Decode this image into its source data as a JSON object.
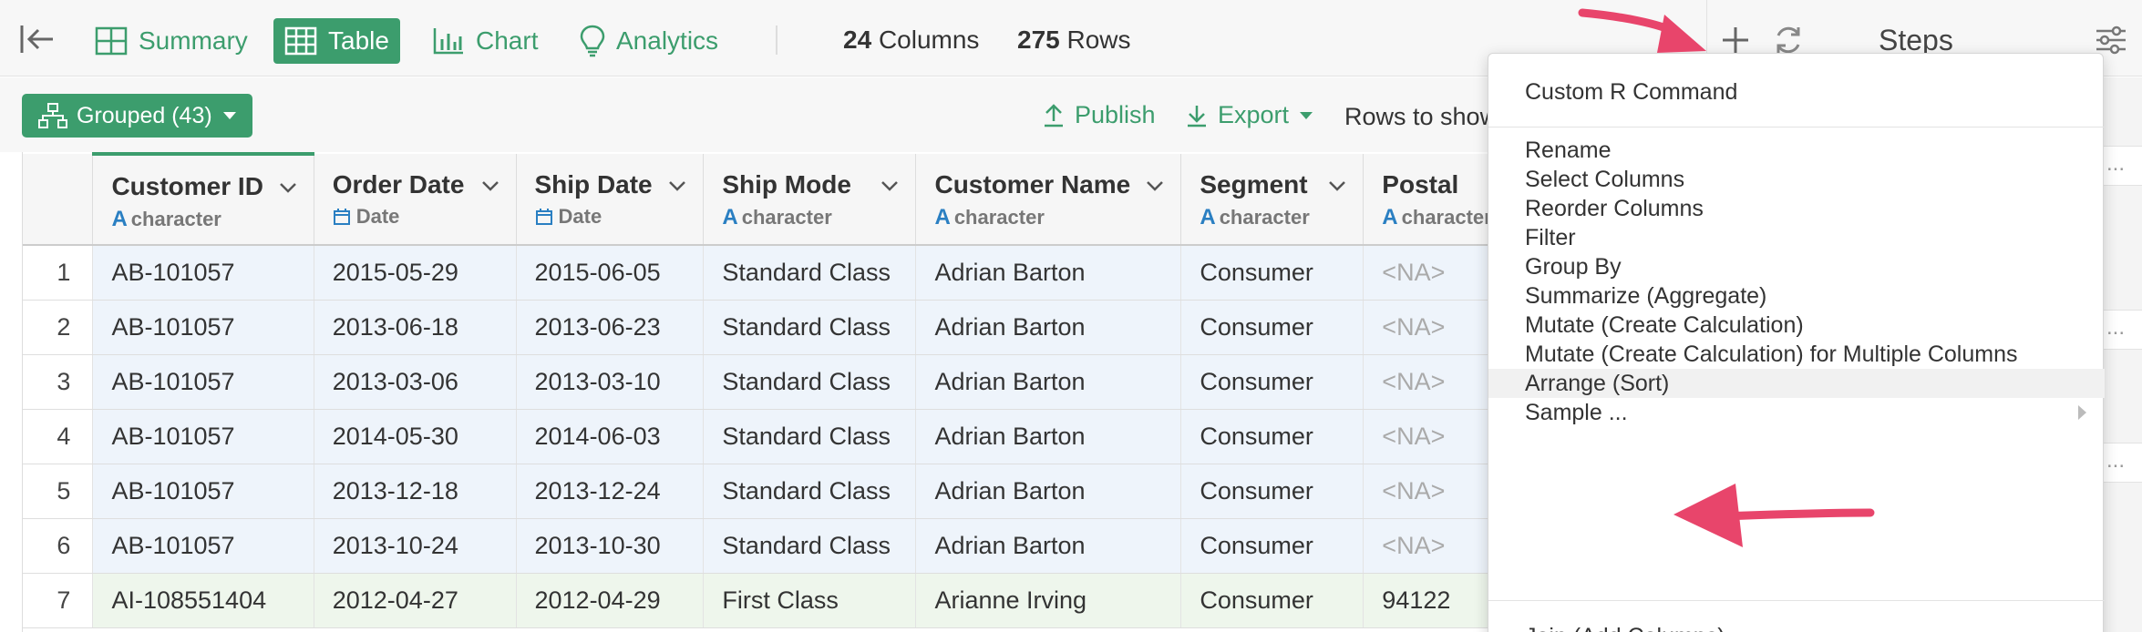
{
  "toolbar": {
    "tabs": [
      {
        "label": "Summary",
        "icon": "summary-grid-icon"
      },
      {
        "label": "Table",
        "icon": "table-icon"
      },
      {
        "label": "Chart",
        "icon": "bar-chart-icon"
      },
      {
        "label": "Analytics",
        "icon": "lightbulb-icon"
      }
    ],
    "columns_count": "24",
    "columns_label": "Columns",
    "rows_count": "275",
    "rows_label": "Rows",
    "steps_title": "Steps"
  },
  "subbar": {
    "grouped_label": "Grouped (43)",
    "publish_label": "Publish",
    "export_label": "Export",
    "rows_to_show_label": "Rows to show"
  },
  "table": {
    "columns": [
      {
        "name": "Customer ID",
        "type": "character"
      },
      {
        "name": "Order Date",
        "type": "Date"
      },
      {
        "name": "Ship Date",
        "type": "Date"
      },
      {
        "name": "Ship Mode",
        "type": "character"
      },
      {
        "name": "Customer Name",
        "type": "character"
      },
      {
        "name": "Segment",
        "type": "character"
      },
      {
        "name": "Postal",
        "type": "character"
      }
    ],
    "rows": [
      [
        "1",
        "AB-101057",
        "2015-05-29",
        "2015-06-05",
        "Standard Class",
        "Adrian Barton",
        "Consumer",
        "<NA>"
      ],
      [
        "2",
        "AB-101057",
        "2013-06-18",
        "2013-06-23",
        "Standard Class",
        "Adrian Barton",
        "Consumer",
        "<NA>"
      ],
      [
        "3",
        "AB-101057",
        "2013-03-06",
        "2013-03-10",
        "Standard Class",
        "Adrian Barton",
        "Consumer",
        "<NA>"
      ],
      [
        "4",
        "AB-101057",
        "2014-05-30",
        "2014-06-03",
        "Standard Class",
        "Adrian Barton",
        "Consumer",
        "<NA>"
      ],
      [
        "5",
        "AB-101057",
        "2013-12-18",
        "2013-12-24",
        "Standard Class",
        "Adrian Barton",
        "Consumer",
        "<NA>"
      ],
      [
        "6",
        "AB-101057",
        "2013-10-24",
        "2013-10-30",
        "Standard Class",
        "Adrian Barton",
        "Consumer",
        "<NA>"
      ],
      [
        "7",
        "AI-108551404",
        "2012-04-27",
        "2012-04-29",
        "First Class",
        "Arianne Irving",
        "Consumer",
        "94122"
      ]
    ]
  },
  "menu": {
    "top_item": "Custom R Command",
    "items": [
      "Rename",
      "Select Columns",
      "Reorder Columns",
      "Filter",
      "Group By",
      "Summarize (Aggregate)",
      "Mutate (Create Calculation)",
      "Mutate (Create Calculation) for Multiple Columns",
      "Arrange (Sort)",
      "Sample ..."
    ],
    "highlighted_item": "Arrange (Sort)",
    "partial_item": "Join (Add Columns)"
  },
  "colors": {
    "accent": "#3c9d6d",
    "annotation_arrow": "#e8456b",
    "type_icon": "#2a7fc2"
  },
  "steps_stub": [
    "...",
    "...",
    "..."
  ]
}
